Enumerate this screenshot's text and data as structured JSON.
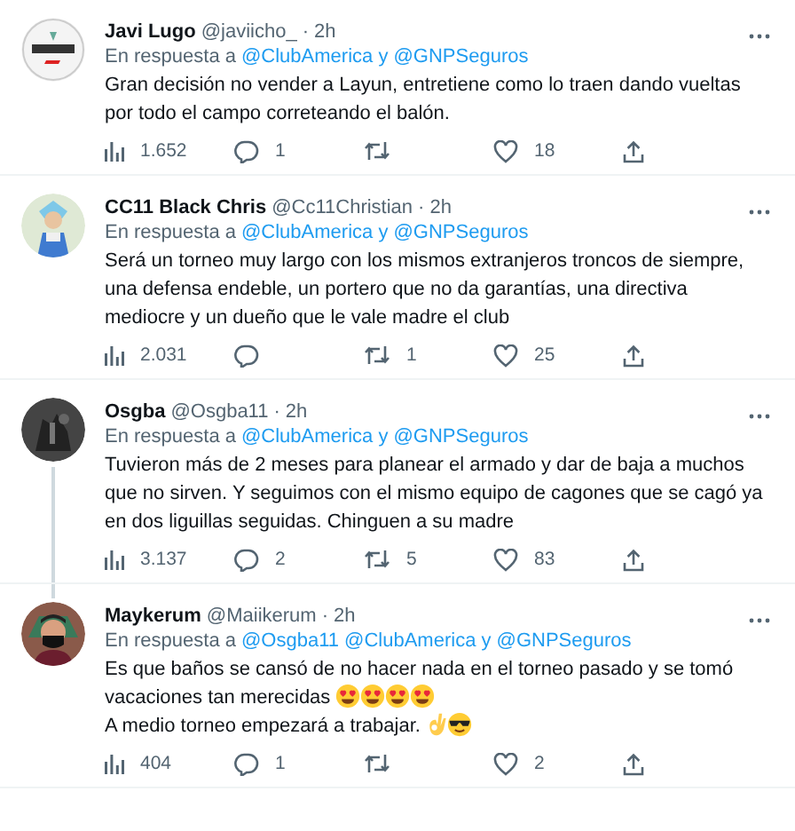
{
  "tweets": [
    {
      "name": "Javi Lugo",
      "handle": "@javiicho_",
      "time": "2h",
      "separator": "·",
      "reply_label": "En respuesta a",
      "reply_to": "@ClubAmerica y @GNPSeguros",
      "thread_above": false,
      "thread_below": false,
      "body": [
        {
          "text": "Gran decisión no vender a Layun, entretiene como lo traen dando vueltas por todo el campo correteando el balón."
        }
      ],
      "actions": [
        {
          "kind": "views",
          "count": "1.652"
        },
        {
          "kind": "reply",
          "count": "1"
        },
        {
          "kind": "retweet"
        },
        {
          "kind": "like",
          "count": "18"
        },
        {
          "kind": "share"
        }
      ]
    },
    {
      "name": "CC11 Black Chris",
      "handle": "@Cc11Christian",
      "time": "2h",
      "separator": "·",
      "reply_label": "En respuesta a",
      "reply_to": "@ClubAmerica y @GNPSeguros",
      "thread_above": false,
      "thread_below": false,
      "body": [
        {
          "text": "Será un torneo muy largo con los mismos extranjeros troncos de siempre, una defensa endeble, un portero que no da garantías, una directiva mediocre y un dueño que le vale madre el club"
        }
      ],
      "actions": [
        {
          "kind": "views",
          "count": "2.031"
        },
        {
          "kind": "reply"
        },
        {
          "kind": "retweet",
          "count": "1"
        },
        {
          "kind": "like",
          "count": "25"
        },
        {
          "kind": "share"
        }
      ]
    },
    {
      "name": "Osgba",
      "handle": "@Osgba11",
      "time": "2h",
      "separator": "·",
      "reply_label": "En respuesta a",
      "reply_to": "@ClubAmerica y @GNPSeguros",
      "thread_above": false,
      "thread_below": true,
      "body": [
        {
          "text": "Tuvieron más de 2 meses para planear el armado y dar de baja a muchos que no sirven. Y seguimos con el mismo equipo de cagones que se cagó ya en dos liguillas seguidas. Chinguen a su madre"
        }
      ],
      "actions": [
        {
          "kind": "views",
          "count": "3.137"
        },
        {
          "kind": "reply",
          "count": "2"
        },
        {
          "kind": "retweet",
          "count": "5"
        },
        {
          "kind": "like",
          "count": "83"
        },
        {
          "kind": "share"
        }
      ]
    },
    {
      "name": "Maykerum",
      "handle": "@Maiikerum",
      "time": "2h",
      "separator": "·",
      "reply_label": "En respuesta a",
      "reply_to": "@Osgba11 @ClubAmerica y @GNPSeguros",
      "thread_above": true,
      "thread_below": false,
      "body": [
        {
          "text": "Es que baños se cansó de no hacer nada en el torneo pasado y se tomó vacaciones tan merecidas",
          "emojis": [
            {
              "kind": "heart_eyes"
            },
            {
              "kind": "heart_eyes"
            },
            {
              "kind": "heart_eyes"
            },
            {
              "kind": "heart_eyes"
            }
          ]
        },
        {
          "text": "A medio torneo empezará a trabajar.",
          "emojis": [
            {
              "kind": "ok_hand"
            },
            {
              "kind": "sunglasses"
            }
          ]
        }
      ],
      "actions": [
        {
          "kind": "views",
          "count": "404"
        },
        {
          "kind": "reply",
          "count": "1"
        },
        {
          "kind": "retweet"
        },
        {
          "kind": "like",
          "count": "2"
        },
        {
          "kind": "share"
        }
      ]
    }
  ]
}
